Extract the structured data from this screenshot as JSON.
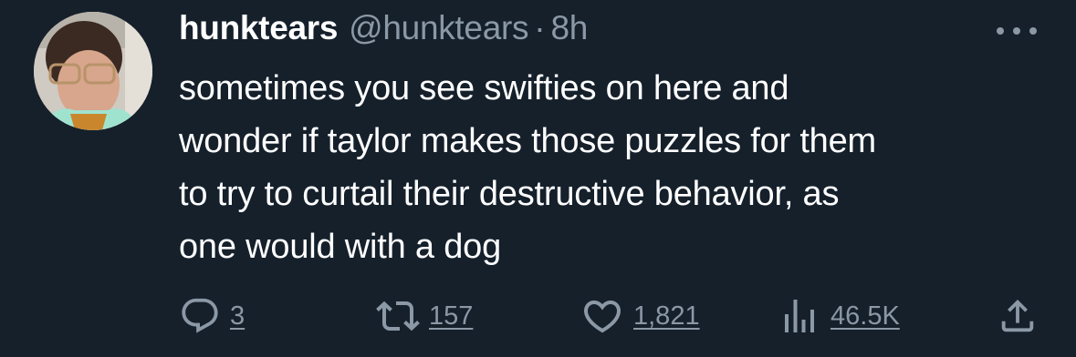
{
  "tweet": {
    "display_name": "hunktears",
    "handle": "@hunktears",
    "separator": "·",
    "time": "8h",
    "text_lines": [
      "sometimes you see swifties on here and",
      "wonder if taylor makes those puzzles for them",
      "to try to curtail their destructive behavior, as",
      "one would with a dog"
    ]
  },
  "actions": {
    "replies": "3",
    "retweets": "157",
    "likes": "1,821",
    "views": "46.5K"
  },
  "icons": {
    "reply": "reply-icon",
    "retweet": "retweet-icon",
    "like": "heart-icon",
    "views": "views-icon",
    "share": "share-icon",
    "more": "more-icon"
  },
  "colors": {
    "background": "#15202b",
    "text": "#ffffff",
    "secondary": "#8b98a5"
  }
}
